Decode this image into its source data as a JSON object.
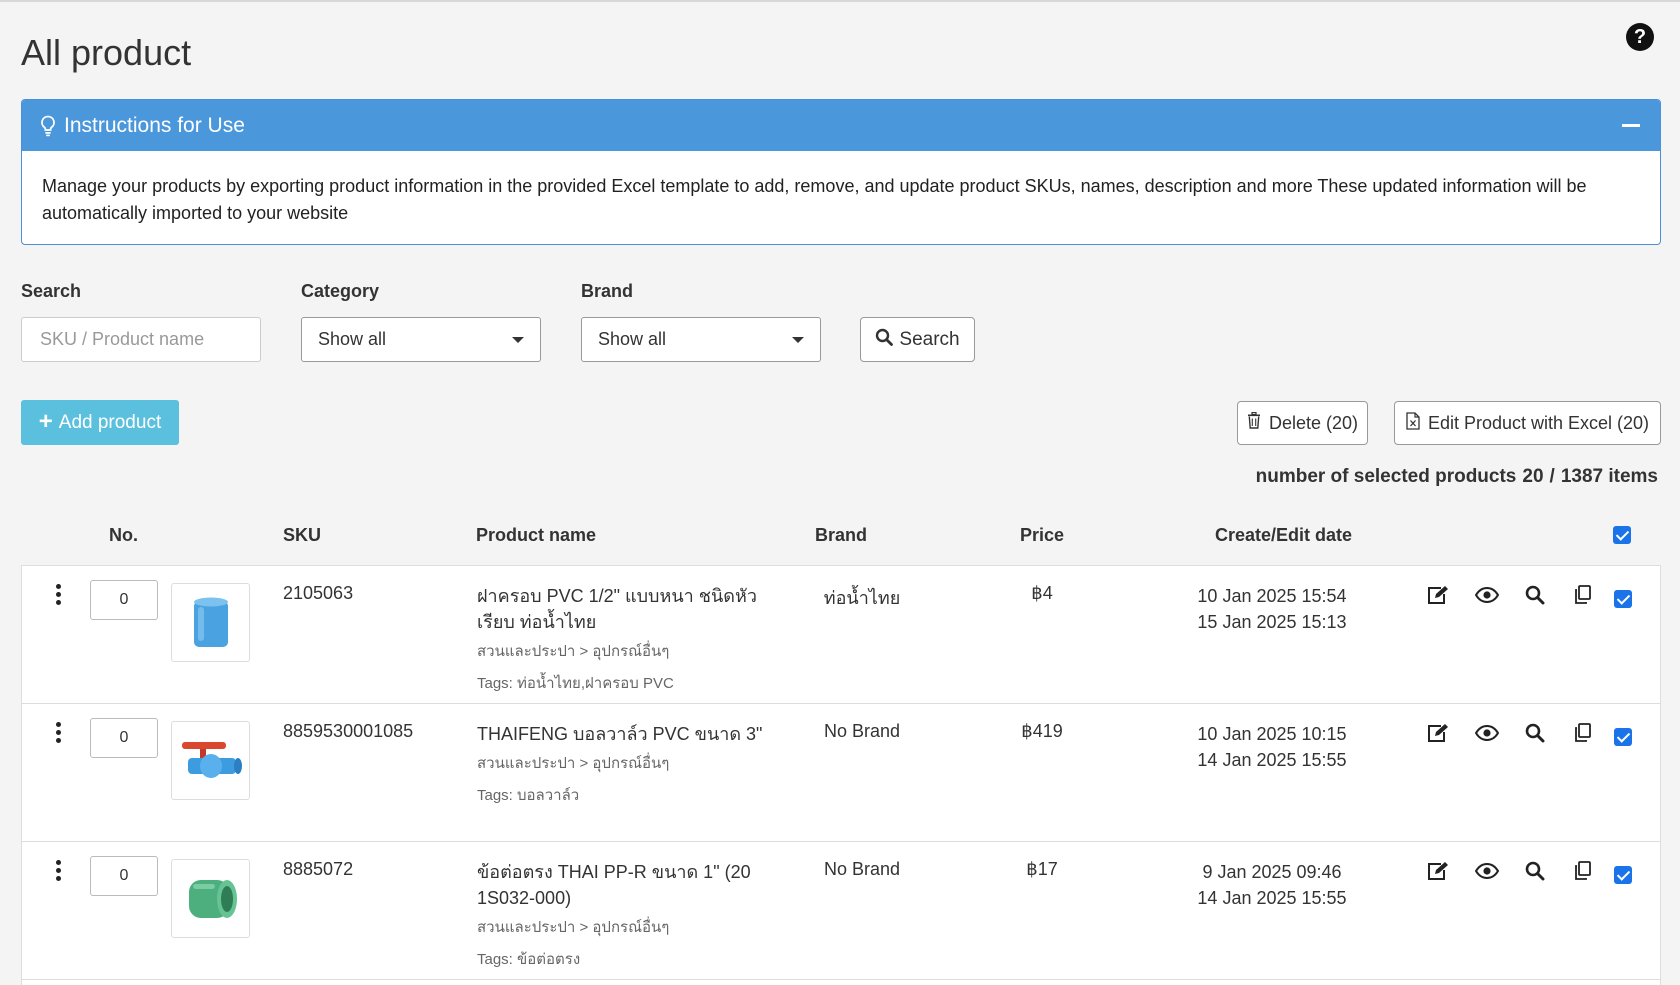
{
  "page": {
    "title": "All product"
  },
  "instructions": {
    "title": "Instructions for Use",
    "body": "Manage your products by exporting product information in the provided Excel template to add, remove, and update product SKUs, names, description and more These updated information will be automatically imported to your website"
  },
  "filters": {
    "search_label": "Search",
    "search_placeholder": "SKU / Product name",
    "category_label": "Category",
    "category_value": "Show all",
    "brand_label": "Brand",
    "brand_value": "Show all",
    "search_button": "Search"
  },
  "actions": {
    "add_product": "Add product",
    "delete": "Delete (20)",
    "edit_excel": "Edit Product with Excel (20)"
  },
  "selection": {
    "prefix": "number of selected products",
    "selected": "20",
    "separator": "/",
    "total": "1387 items"
  },
  "table": {
    "headers": {
      "no": "No.",
      "sku": "SKU",
      "name": "Product name",
      "brand": "Brand",
      "price": "Price",
      "date": "Create/Edit date"
    },
    "rows": [
      {
        "qty": "0",
        "thumb_icon": "blue-pvc-cap-image",
        "sku": "2105063",
        "name": "ฝาครอบ PVC 1/2\" แบบหนา ชนิดหัวเรียบ ท่อน้ำไทย",
        "category": "สวนและประปา > อุปกรณ์อื่นๆ",
        "tags": "Tags: ท่อน้ำไทย,ฝาครอบ PVC",
        "brand": "ท่อน้ำไทย",
        "price": "฿4",
        "created": "10 Jan 2025 15:54",
        "edited": "15 Jan 2025 15:13"
      },
      {
        "qty": "0",
        "thumb_icon": "ball-valve-image",
        "sku": "8859530001085",
        "name": "THAIFENG บอลวาล์ว PVC ขนาด 3\"",
        "category": "สวนและประปา > อุปกรณ์อื่นๆ",
        "tags": "Tags: บอลวาล์ว",
        "brand": "No Brand",
        "price": "฿419",
        "created": "10 Jan 2025 10:15",
        "edited": "14 Jan 2025 15:55"
      },
      {
        "qty": "0",
        "thumb_icon": "green-ppr-coupling-image",
        "sku": "8885072",
        "name": "ข้อต่อตรง THAI PP-R ขนาด 1\" (20 1S032-000)",
        "category": "สวนและประปา > อุปกรณ์อื่นๆ",
        "tags": "Tags: ข้อต่อตรง",
        "brand": "No Brand",
        "price": "฿17",
        "created": "9 Jan 2025 09:46",
        "edited": "14 Jan 2025 15:55"
      }
    ]
  },
  "colors": {
    "accent_blue": "#4a97dc",
    "add_button": "#5bc0de",
    "checkbox": "#1a73e8"
  },
  "icons": [
    "help-icon",
    "lightbulb-icon",
    "minimize-icon",
    "search-icon",
    "plus-icon",
    "trash-icon",
    "excel-file-icon",
    "kebab-menu-icon",
    "edit-icon",
    "view-icon",
    "zoom-icon",
    "copy-icon",
    "checkbox-icon"
  ]
}
